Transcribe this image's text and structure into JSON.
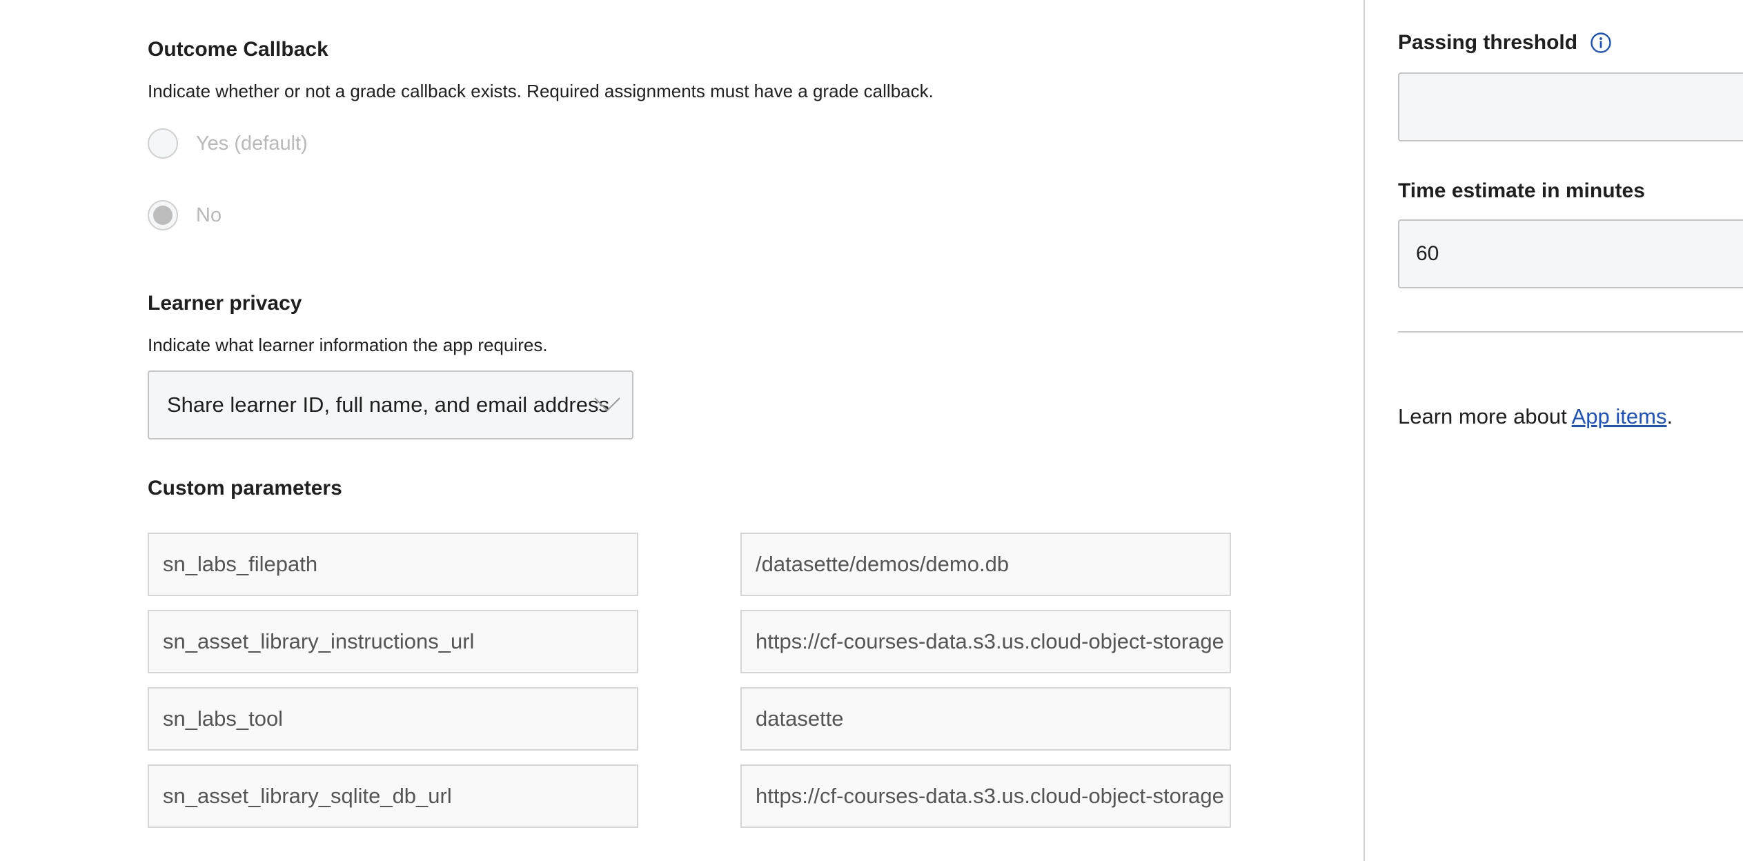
{
  "outcome_callback": {
    "title": "Outcome Callback",
    "description": "Indicate whether or not a grade callback exists. Required assignments must have a grade callback.",
    "options": [
      {
        "label": "Yes (default)",
        "selected": false
      },
      {
        "label": "No",
        "selected": true
      }
    ]
  },
  "learner_privacy": {
    "title": "Learner privacy",
    "description": "Indicate what learner information the app requires.",
    "selected_value": "Share learner ID, full name, and email address"
  },
  "custom_parameters": {
    "title": "Custom parameters",
    "rows": [
      {
        "key": "sn_labs_filepath",
        "value": "/datasette/demos/demo.db"
      },
      {
        "key": "sn_asset_library_instructions_url",
        "value": "https://cf-courses-data.s3.us.cloud-object-storage"
      },
      {
        "key": "sn_labs_tool",
        "value": "datasette"
      },
      {
        "key": "sn_asset_library_sqlite_db_url",
        "value": "https://cf-courses-data.s3.us.cloud-object-storage"
      }
    ]
  },
  "sidebar": {
    "passing_threshold": {
      "label": "Passing threshold",
      "value": "",
      "suffix": "%",
      "icon": "info-icon"
    },
    "time_estimate": {
      "label": "Time estimate in minutes",
      "value": "60"
    },
    "learn_more": {
      "prefix": "Learn more about ",
      "link": "App items",
      "suffix": "."
    }
  },
  "colors": {
    "link": "#1a52c2",
    "info_icon": "#1a52c2",
    "field_bg": "#f5f6f7",
    "disabled_text": "#b9b9b9"
  }
}
